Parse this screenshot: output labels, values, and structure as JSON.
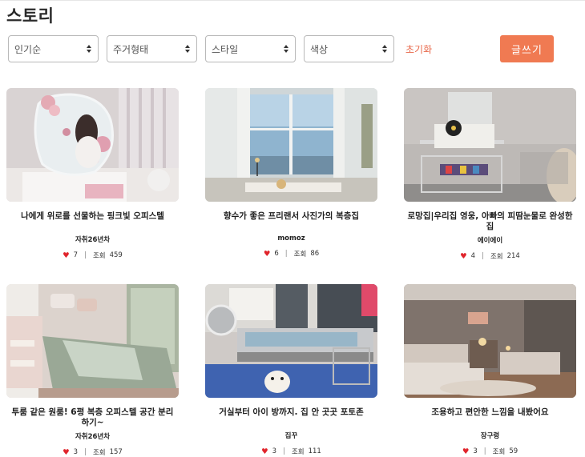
{
  "page": {
    "title": "스토리"
  },
  "filters": {
    "sort": "인기순",
    "housing": "주거형태",
    "style": "스타일",
    "color": "색상",
    "reset_label": "초기화",
    "write_label": "글쓰기"
  },
  "stats_labels": {
    "views": "조회"
  },
  "cards": [
    {
      "title": "나에게 위로를 선물하는 핑크빛 오피스텔",
      "author": "자취26년차",
      "likes": "7",
      "views": "459"
    },
    {
      "title": "향수가 좋은 프리랜서 사진가의 복층집",
      "author": "momoz",
      "likes": "6",
      "views": "86"
    },
    {
      "title": "로망집|우리집 영웅, 아빠의 피땀눈물로 완성한 집",
      "author": "에이에이",
      "likes": "4",
      "views": "214"
    },
    {
      "title": "투룸 같은 원룸! 6평 복층 오피스텔 공간 분리하기~",
      "author": "자취26년차",
      "likes": "3",
      "views": "157"
    },
    {
      "title": "거실부터 아이 방까지. 집 안 곳곳 포토존",
      "author": "집꾸",
      "likes": "3",
      "views": "111"
    },
    {
      "title": "조용하고 편안한 느낌을 내봤어요",
      "author": "장구령",
      "likes": "3",
      "views": "59"
    }
  ]
}
